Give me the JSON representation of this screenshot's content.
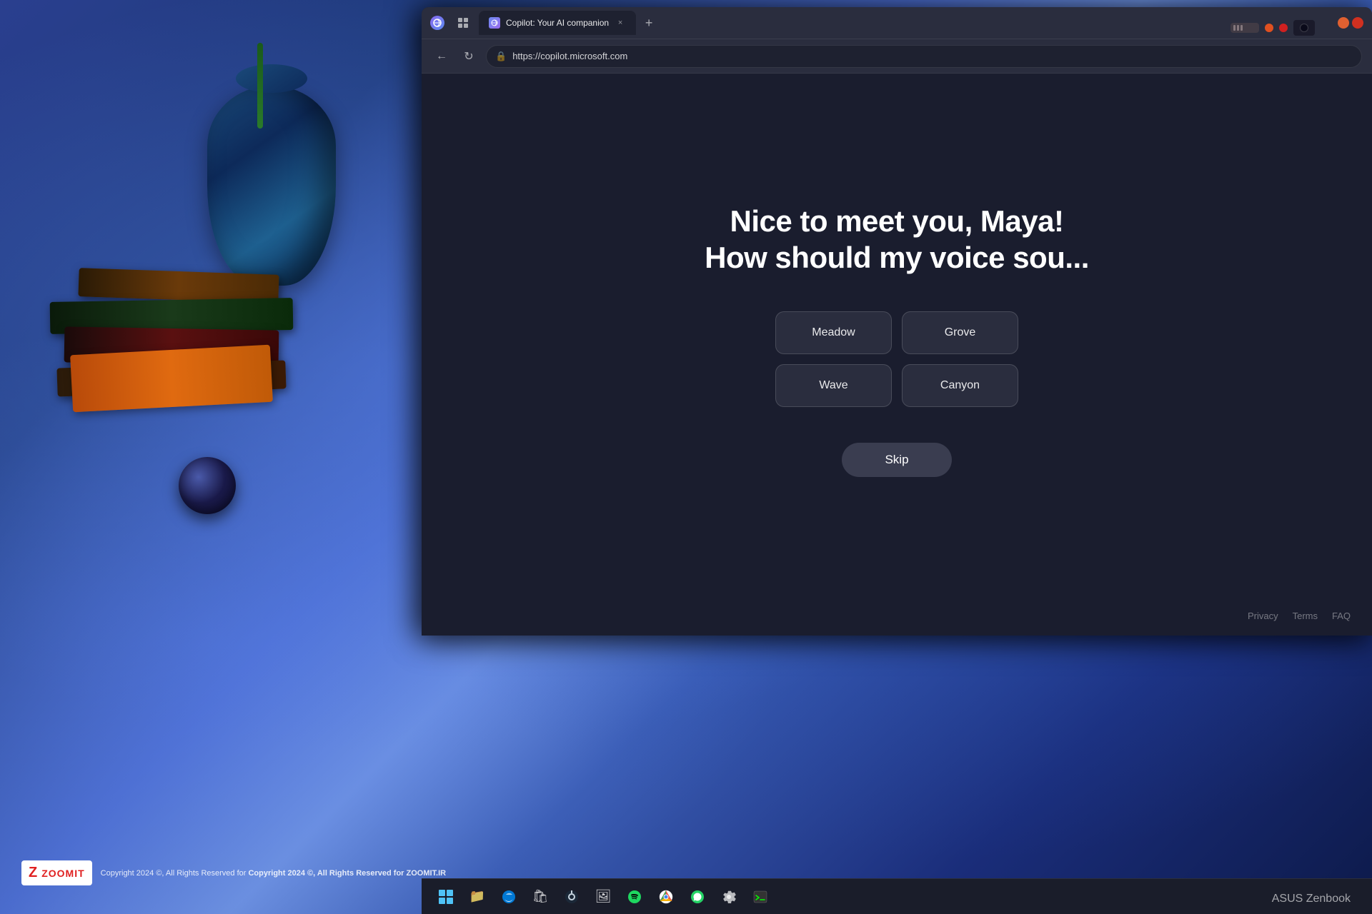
{
  "desktop": {
    "background": "blue ambient desk scene"
  },
  "browser": {
    "tab": {
      "title": "Copilot: Your AI companion",
      "favicon": "copilot-icon",
      "close_label": "×"
    },
    "new_tab_label": "+",
    "controls": {
      "back_label": "←",
      "forward_label": "→",
      "refresh_label": "↻"
    },
    "address": "https://copilot.microsoft.com",
    "lock_icon": "🔒"
  },
  "copilot": {
    "greeting_line1": "Nice to meet you, Maya!",
    "greeting_line2": "How should my voice sou...",
    "voice_options": [
      {
        "id": "meadow",
        "label": "Meadow"
      },
      {
        "id": "grove",
        "label": "Grove"
      },
      {
        "id": "wave",
        "label": "Wave"
      },
      {
        "id": "canyon",
        "label": "Canyon"
      }
    ],
    "skip_label": "Skip"
  },
  "footer": {
    "links": [
      "Privacy",
      "Terms",
      "FAQ"
    ]
  },
  "taskbar": {
    "icons": [
      {
        "id": "windows-start",
        "name": "windows-start-icon",
        "label": ""
      },
      {
        "id": "file-explorer",
        "name": "file-explorer-icon",
        "label": "📁"
      },
      {
        "id": "edge",
        "name": "edge-icon",
        "label": ""
      },
      {
        "id": "microsoft-store",
        "name": "store-icon",
        "label": "🏪"
      },
      {
        "id": "steam",
        "name": "steam-icon",
        "label": "🎮"
      },
      {
        "id": "photos",
        "name": "photos-icon",
        "label": "🖼"
      },
      {
        "id": "spotify",
        "name": "spotify-icon",
        "label": "🎵"
      },
      {
        "id": "chrome",
        "name": "chrome-icon",
        "label": ""
      },
      {
        "id": "whatsapp",
        "name": "whatsapp-icon",
        "label": "💬"
      },
      {
        "id": "settings",
        "name": "settings-icon",
        "label": "⚙"
      },
      {
        "id": "terminal",
        "name": "terminal-icon",
        "label": ">"
      }
    ],
    "laptop_brand": "ASUS Zenbook"
  },
  "watermark": {
    "logo": "Z ZOOMIT",
    "copyright": "Copyright 2024 ©, All Rights Reserved for ZOOMIT.IR"
  }
}
